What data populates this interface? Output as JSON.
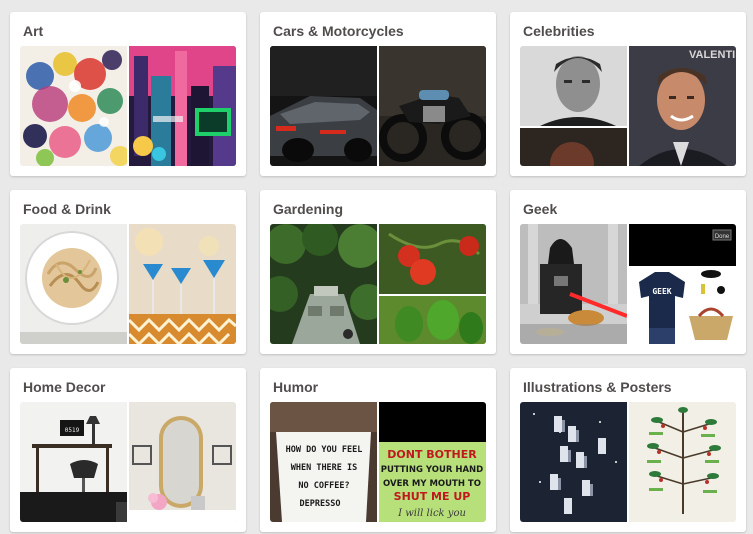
{
  "categories": [
    {
      "title": "Art"
    },
    {
      "title": "Cars & Motorcycles"
    },
    {
      "title": "Celebrities"
    },
    {
      "title": "Food & Drink"
    },
    {
      "title": "Gardening"
    },
    {
      "title": "Geek"
    },
    {
      "title": "Home Decor"
    },
    {
      "title": "Humor"
    },
    {
      "title": "Illustrations & Posters"
    }
  ],
  "image_text": {
    "celebrities_bg": "VALENTINE'S",
    "geek_done": "Done",
    "geek_shirt": "GEEK",
    "home_clock": "0519",
    "humor_sign": [
      "HOW DO YOU FEEL",
      "WHEN THERE IS",
      "NO COFFEE?",
      "DEPRESSO"
    ],
    "humor_poster": [
      "DONT BOTHER",
      "PUTTING YOUR HAND",
      "OVER MY MOUTH TO",
      "SHUT ME UP",
      "I will lick you"
    ]
  },
  "colors": {
    "page_bg": "#e9e9e9",
    "card_bg": "#ffffff",
    "title_text": "#524d4d"
  }
}
